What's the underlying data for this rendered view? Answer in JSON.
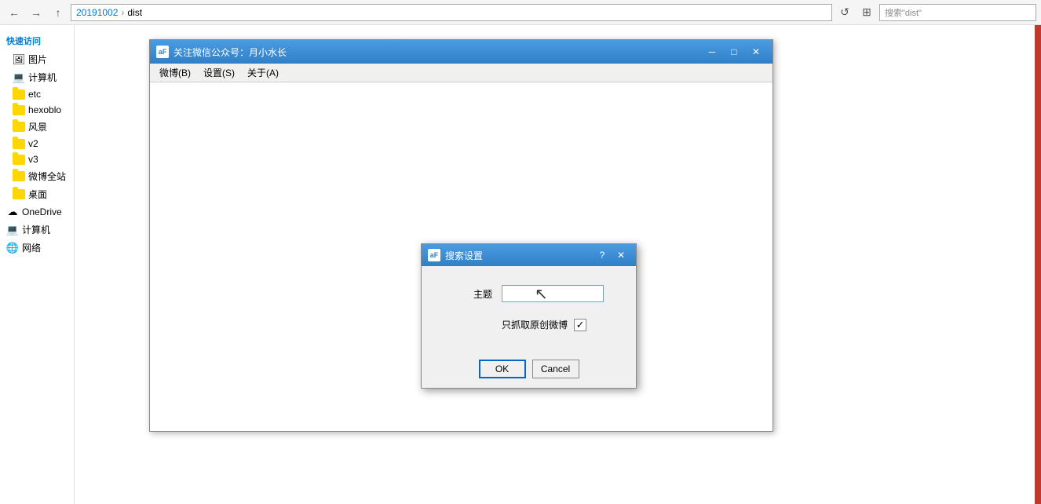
{
  "explorer": {
    "nav": {
      "back_label": "←",
      "forward_label": "→",
      "up_label": "↑",
      "breadcrumb": [
        "20191002",
        "dist"
      ],
      "refresh_icon": "↺",
      "search_placeholder": "搜索\"dist\"",
      "search_value": "搜索\"dist\""
    },
    "sidebar": {
      "quick_access_label": "快速访问",
      "items": [
        {
          "label": "图片",
          "icon": "folder"
        },
        {
          "label": "计算机",
          "icon": "computer"
        },
        {
          "label": "etc",
          "icon": "folder"
        },
        {
          "label": "hexoblo",
          "icon": "folder"
        },
        {
          "label": "风景",
          "icon": "folder"
        },
        {
          "label": "v2",
          "icon": "folder"
        },
        {
          "label": "v3",
          "icon": "folder"
        },
        {
          "label": "微博全站",
          "icon": "folder"
        },
        {
          "label": "桌面",
          "icon": "folder"
        },
        {
          "label": "OneDrive",
          "icon": "cloud"
        },
        {
          "label": "计算机",
          "icon": "computer"
        },
        {
          "label": "网络",
          "icon": "network"
        }
      ]
    }
  },
  "app_window": {
    "title": "关注微信公众号：月小水长",
    "title_icon": "aF",
    "menu_items": [
      "微博(B)",
      "设置(S)",
      "关于(A)"
    ],
    "minimize": "─",
    "maximize": "□",
    "close": "✕"
  },
  "dialog": {
    "title": "搜索设置",
    "title_icon": "aF",
    "help_btn": "?",
    "close_btn": "✕",
    "subject_label": "主题",
    "subject_value": "",
    "checkbox_label": "只抓取原创微博",
    "checkbox_checked": true,
    "ok_label": "OK",
    "cancel_label": "Cancel"
  }
}
